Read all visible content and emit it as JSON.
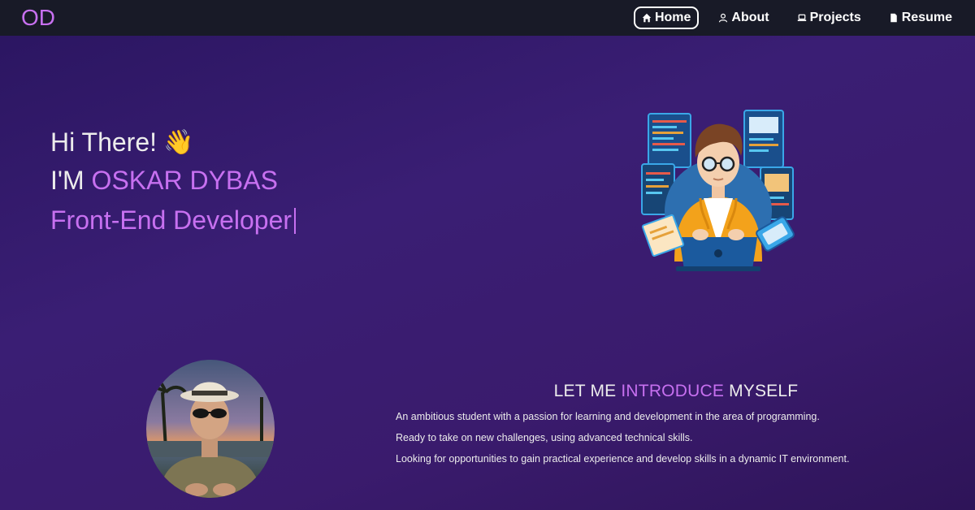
{
  "brand": {
    "logo": "OD"
  },
  "nav": {
    "items": [
      {
        "label": "Home",
        "icon": "home-icon",
        "active": true
      },
      {
        "label": "About",
        "icon": "user-icon",
        "active": false
      },
      {
        "label": "Projects",
        "icon": "laptop-icon",
        "active": false
      },
      {
        "label": "Resume",
        "icon": "document-icon",
        "active": false
      }
    ]
  },
  "hero": {
    "greeting": "Hi There!",
    "wave_emoji": "👋",
    "im_prefix": "I'M",
    "name": "OSKAR DYBAS",
    "role": "Front-End Developer"
  },
  "about": {
    "title_part1": "LET ME",
    "title_accent": "INTRODUCE",
    "title_part2": "MYSELF",
    "paragraphs": [
      "An ambitious student with a passion for learning and development in the area of programming.",
      "Ready to take on new challenges, using advanced technical skills.",
      "Looking for opportunities to gain practical experience and develop skills in a dynamic IT environment."
    ]
  },
  "colors": {
    "accent": "#c770f0",
    "navbar_bg": "#181a27",
    "page_bg": "#3a1e74",
    "text": "#ececec"
  }
}
